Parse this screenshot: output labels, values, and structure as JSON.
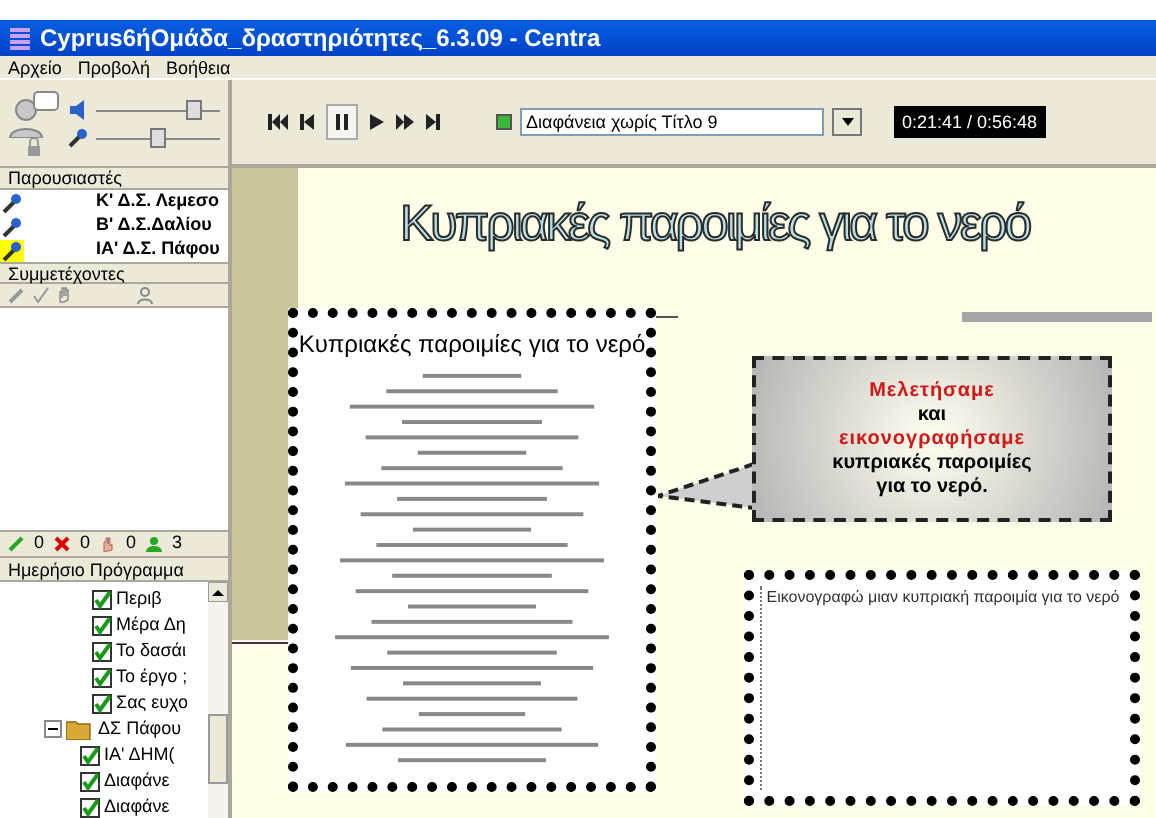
{
  "window": {
    "title": "Cyprus6ήΟμάδα_δραστηριότητες_6.3.09 - Centra"
  },
  "menu": [
    "Αρχείο",
    "Προβολή",
    "Βοήθεια"
  ],
  "audio": {
    "speaker": {
      "level": 0.85
    },
    "microphone": {
      "level": 0.5
    }
  },
  "presenters": {
    "heading": "Παρουσιαστές",
    "items": [
      {
        "name": "Κ' Δ.Σ. Λεμεσο",
        "speaking": false
      },
      {
        "name": "Β' Δ.Σ.Δαλίου",
        "speaking": false
      },
      {
        "name": "ΙΑ' Δ.Σ. Πάφου",
        "speaking": true
      }
    ]
  },
  "participants": {
    "heading": "Συμμετέχοντες"
  },
  "counts": {
    "yes": "0",
    "no": "0",
    "hands": "0",
    "people": "3"
  },
  "schedule": {
    "heading": "Ημερήσιο Πρόγραμμα",
    "tree": [
      {
        "kind": "continued",
        "children": [
          {
            "label": "Περιβ",
            "checked": true
          },
          {
            "label": "Μέρα Δη",
            "checked": true
          },
          {
            "label": "Το δασάι",
            "checked": true
          },
          {
            "label": "Το έργο ;",
            "checked": true
          },
          {
            "label": "Σας ευχο",
            "checked": true
          }
        ]
      },
      {
        "kind": "folder",
        "label": "ΔΣ Πάφου",
        "expanded": true,
        "children": [
          {
            "label": "ΙΑ' ΔΗΜ(",
            "checked": true
          },
          {
            "label": "Διαφάνε",
            "checked": true
          },
          {
            "label": "Διαφάνε",
            "checked": true
          }
        ]
      }
    ]
  },
  "player": {
    "slide_select": "Διαφάνεια χωρίς Τίτλο 9",
    "time": "0:21:41 / 0:56:48",
    "paused": true
  },
  "slide": {
    "title": "Κυπριακές παροιμίες για το νερό",
    "document": {
      "title": "Κυπριακές παροιμίες για το νερό"
    },
    "bubble": [
      {
        "text": "Μελετήσαμε",
        "kind": "highlight"
      },
      {
        "text": "και",
        "kind": "plain"
      },
      {
        "text": "εικονογραφήσαμε",
        "kind": "highlight"
      },
      {
        "text": "κυπριακές παροιμίες",
        "kind": "plain"
      },
      {
        "text": "για το νερό.",
        "kind": "plain"
      }
    ],
    "drawing_box": {
      "caption": "Εικονογραφώ μιαν κυπριακή παροιμία για το νερό"
    }
  }
}
